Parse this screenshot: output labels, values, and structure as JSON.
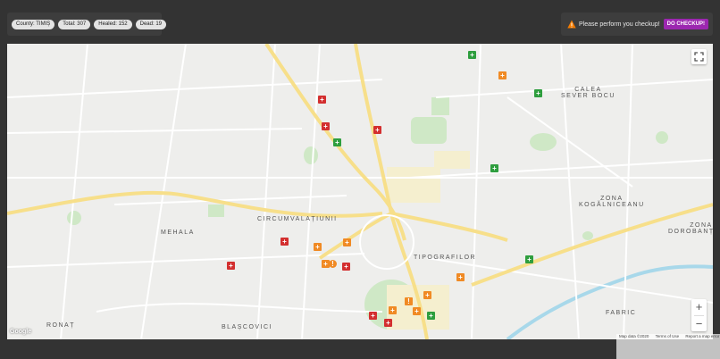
{
  "stats": {
    "county": "County: TIMIȘ",
    "total": "Total: 307",
    "healed": "Healed: 152",
    "dead": "Dead: 19"
  },
  "checkup": {
    "message": "Please perform you checkup!",
    "button": "DO CHECKUP!",
    "accent": "#9c27b0",
    "warning_color": "#f57c00"
  },
  "map": {
    "labels": {
      "calea_sever_bocu": "CALEA\nSEVER BOCU",
      "circumvalatiunii": "CIRCUMVALAȚIUNII",
      "mehala": "MEHALA",
      "zona_kogalniceanu": "ZONA\nKOGĂLNICEANU",
      "zona_dorobantilor": "ZONA\nDOROBANȚILOR",
      "tipografilor": "TIPOGRAFILOR",
      "fabric": "FABRIC",
      "ronat": "RONAȚ",
      "blascovici": "BLAȘCOVICI"
    },
    "provider": "Google",
    "attribution": {
      "data": "Map data ©2020",
      "terms": "Terms of Use",
      "report": "Report a map error"
    },
    "marker_colors": {
      "hospital": "#d32f2f",
      "pharmacy": "#2e9e3e",
      "shop": "#f08a24"
    }
  }
}
